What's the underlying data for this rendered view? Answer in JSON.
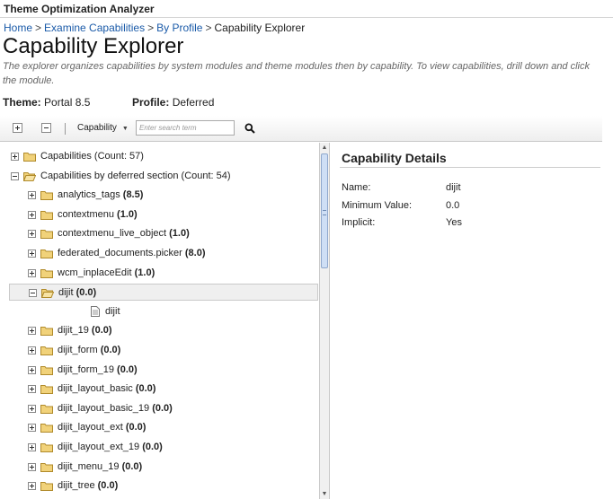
{
  "app": {
    "title": "Theme Optimization Analyzer"
  },
  "breadcrumb": {
    "home": "Home",
    "examine": "Examine Capabilities",
    "by_profile": "By Profile",
    "current": "Capability Explorer",
    "sep": ">"
  },
  "page": {
    "title": "Capability Explorer",
    "description": "The explorer organizes capabilities by system modules and theme modules then by capability. To view capabilities, drill down and click the module."
  },
  "meta": {
    "theme_label": "Theme:",
    "theme_value": "Portal 8.5",
    "profile_label": "Profile:",
    "profile_value": "Deferred"
  },
  "toolbar": {
    "select_value": "Capability",
    "search_placeholder": "Enter search term",
    "search_value": ""
  },
  "tree": {
    "items": [
      {
        "name": "Capabilities",
        "extra": " (Count: 57)",
        "toggle": "plus",
        "folder": "closed",
        "depth": 0
      },
      {
        "name": "Capabilities by deferred section",
        "extra": " (Count: 54)",
        "toggle": "minus",
        "folder": "open",
        "depth": 0
      },
      {
        "name": "analytics_tags",
        "value": "(8.5)",
        "toggle": "plus",
        "folder": "closed",
        "depth": 1
      },
      {
        "name": "contextmenu",
        "value": "(1.0)",
        "toggle": "plus",
        "folder": "closed",
        "depth": 1
      },
      {
        "name": "contextmenu_live_object",
        "value": "(1.0)",
        "toggle": "plus",
        "folder": "closed",
        "depth": 1
      },
      {
        "name": "federated_documents.picker",
        "value": "(8.0)",
        "toggle": "plus",
        "folder": "closed",
        "depth": 1
      },
      {
        "name": "wcm_inplaceEdit",
        "value": "(1.0)",
        "toggle": "plus",
        "folder": "closed",
        "depth": 1
      },
      {
        "name": "dijit",
        "value": "(0.0)",
        "toggle": "minus",
        "folder": "open",
        "depth": 1,
        "selected": true
      },
      {
        "name": "dijit",
        "value": "",
        "toggle": "none",
        "folder": "file",
        "depth": 2
      },
      {
        "name": "dijit_19",
        "value": "(0.0)",
        "toggle": "plus",
        "folder": "closed",
        "depth": 1
      },
      {
        "name": "dijit_form",
        "value": "(0.0)",
        "toggle": "plus",
        "folder": "closed",
        "depth": 1
      },
      {
        "name": "dijit_form_19",
        "value": "(0.0)",
        "toggle": "plus",
        "folder": "closed",
        "depth": 1
      },
      {
        "name": "dijit_layout_basic",
        "value": "(0.0)",
        "toggle": "plus",
        "folder": "closed",
        "depth": 1
      },
      {
        "name": "dijit_layout_basic_19",
        "value": "(0.0)",
        "toggle": "plus",
        "folder": "closed",
        "depth": 1
      },
      {
        "name": "dijit_layout_ext",
        "value": "(0.0)",
        "toggle": "plus",
        "folder": "closed",
        "depth": 1
      },
      {
        "name": "dijit_layout_ext_19",
        "value": "(0.0)",
        "toggle": "plus",
        "folder": "closed",
        "depth": 1
      },
      {
        "name": "dijit_menu_19",
        "value": "(0.0)",
        "toggle": "plus",
        "folder": "closed",
        "depth": 1
      },
      {
        "name": "dijit_tree",
        "value": "(0.0)",
        "toggle": "plus",
        "folder": "closed",
        "depth": 1
      }
    ]
  },
  "details": {
    "title": "Capability Details",
    "name_label": "Name:",
    "name_value": "dijit",
    "min_label": "Minimum Value:",
    "min_value": "0.0",
    "implicit_label": "Implicit:",
    "implicit_value": "Yes"
  },
  "colors": {
    "link": "#1a5aa8",
    "folder": "#e8c26a",
    "scroll_thumb": "#cfdff5"
  },
  "icons": {
    "expand_all": "expand-all-icon",
    "collapse_all": "collapse-all-icon",
    "search": "magnifier-icon",
    "folder": "folder-icon",
    "file": "document-icon"
  }
}
